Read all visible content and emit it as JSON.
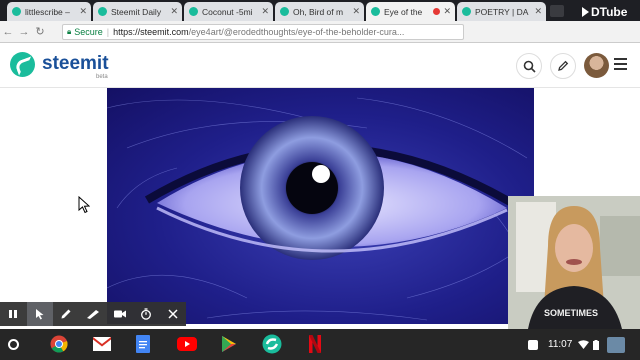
{
  "tabs": [
    {
      "label": "littlescribe –",
      "active": false
    },
    {
      "label": "Steemit Daily",
      "active": false
    },
    {
      "label": "Coconut -5mi",
      "active": false
    },
    {
      "label": "Oh, Bird of m",
      "active": false
    },
    {
      "label": "Eye of the",
      "active": true,
      "recording": true
    },
    {
      "label": "POETRY | DA",
      "active": false
    }
  ],
  "overlay_brand": "DTube",
  "address_bar": {
    "secure_label": "Secure",
    "url_host": "https://steemit.com",
    "url_path": "/eye4art/@erodedthoughts/eye-of-the-beholder-cura..."
  },
  "site": {
    "logo_text": "steemit",
    "logo_beta": "beta"
  },
  "webcam": {
    "shirt_text": "SOMETIMES"
  },
  "recording_toolbar": {
    "tools": [
      "pause-icon",
      "pointer-icon",
      "pen-icon",
      "highlighter-icon",
      "camera-icon",
      "timer-icon",
      "close-icon"
    ]
  },
  "shelf": {
    "apps": [
      "chrome-icon",
      "gmail-icon",
      "docs-icon",
      "youtube-icon",
      "play-store-icon",
      "steemit-icon",
      "netflix-icon"
    ],
    "clock": "11:07"
  },
  "colors": {
    "steemit_teal": "#1abc9c",
    "steemit_navy": "#1a5099",
    "secure_green": "#0b8043"
  }
}
